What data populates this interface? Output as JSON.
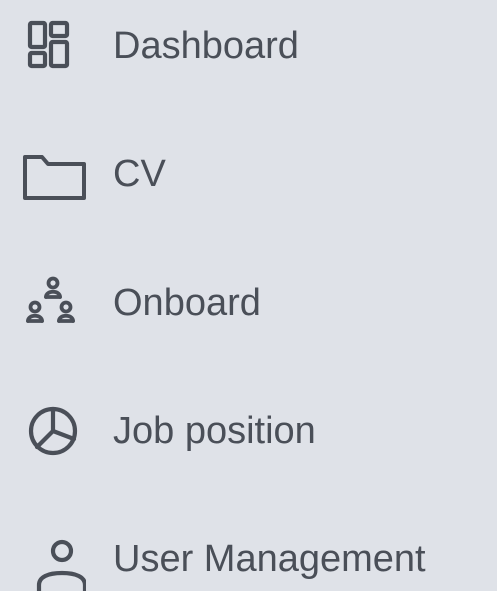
{
  "sidebar": {
    "items": [
      {
        "label": "Dashboard",
        "icon": "dashboard-grid-icon"
      },
      {
        "label": "CV",
        "icon": "folder-icon"
      },
      {
        "label": "Onboard",
        "icon": "users-group-icon"
      },
      {
        "label": "Job position",
        "icon": "pie-chart-icon"
      },
      {
        "label": "User Management",
        "icon": "user-icon"
      }
    ]
  },
  "colors": {
    "background": "#dfe2e8",
    "text": "#4a4f58",
    "icon_stroke": "#4a4f58"
  }
}
